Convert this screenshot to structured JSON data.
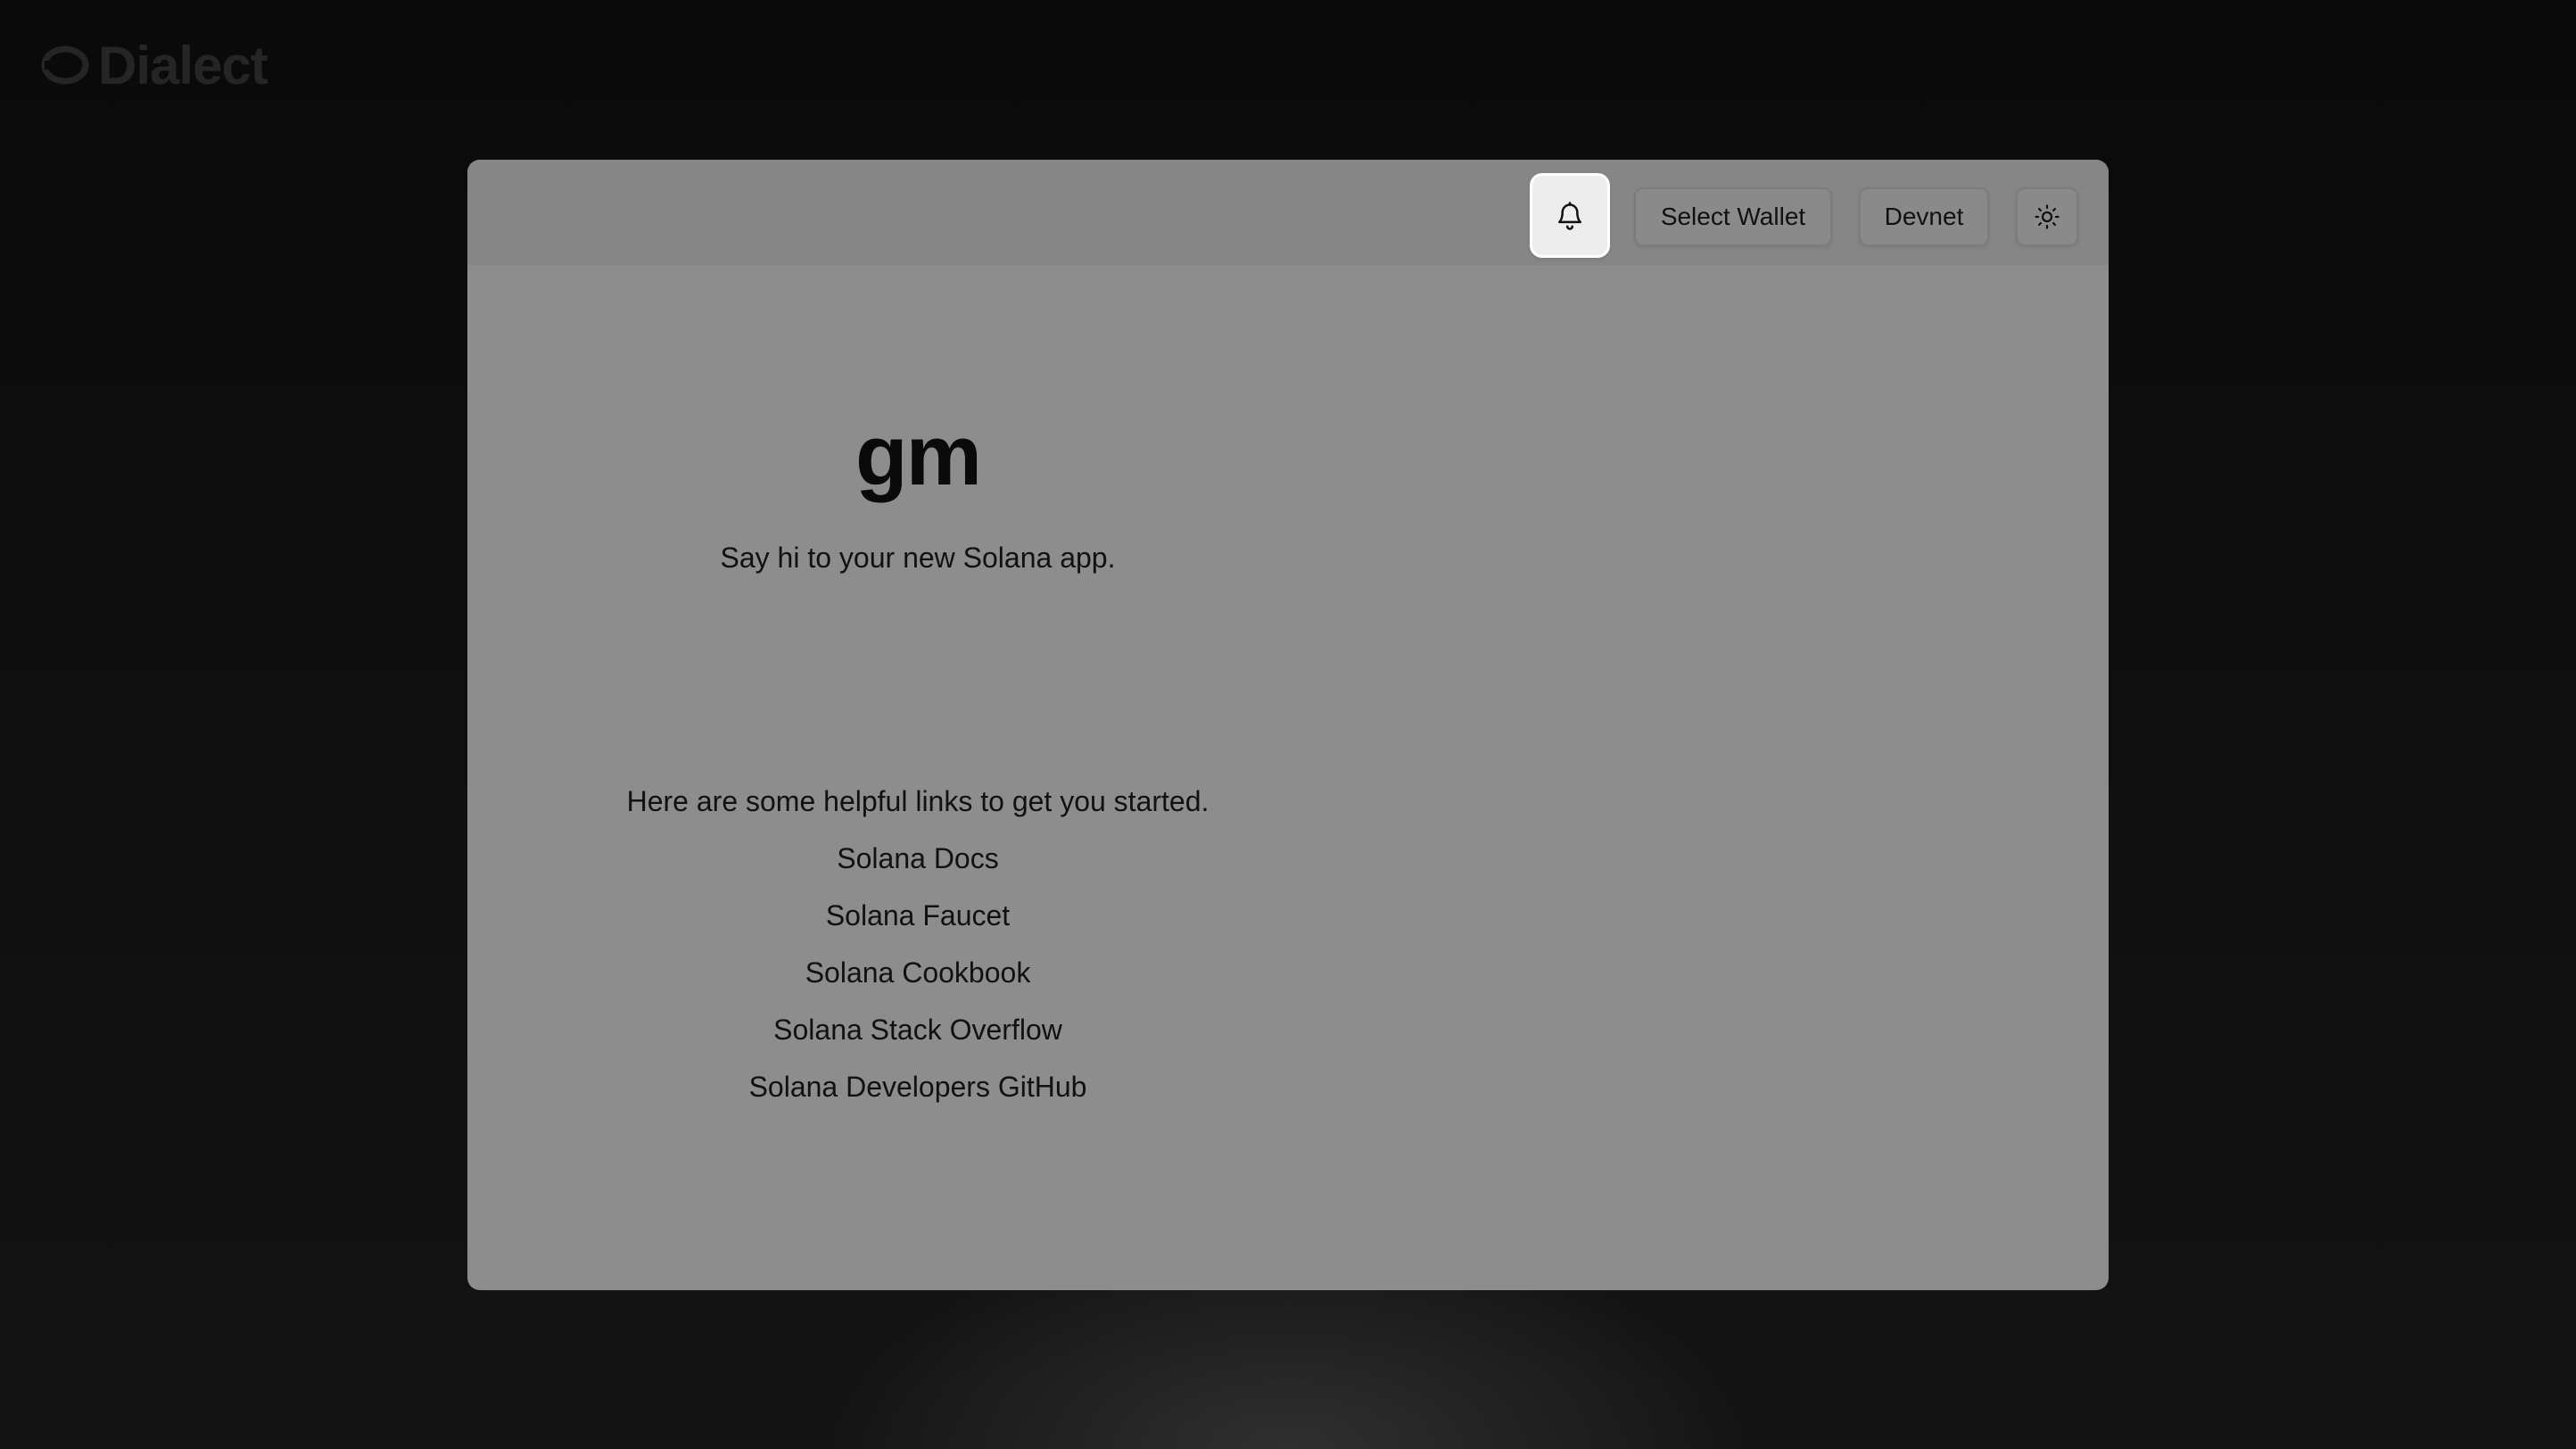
{
  "brand": {
    "name": "Dialect"
  },
  "header": {
    "notifications_icon": "bell-icon",
    "select_wallet_label": "Select Wallet",
    "network_label": "Devnet",
    "theme_icon": "sun-icon"
  },
  "main": {
    "title": "gm",
    "tagline": "Say hi to your new Solana app.",
    "links_intro": "Here are some helpful links to get you started.",
    "links": [
      {
        "label": "Solana Docs"
      },
      {
        "label": "Solana Faucet"
      },
      {
        "label": "Solana Cookbook"
      },
      {
        "label": "Solana Stack Overflow"
      },
      {
        "label": "Solana Developers GitHub"
      }
    ]
  }
}
